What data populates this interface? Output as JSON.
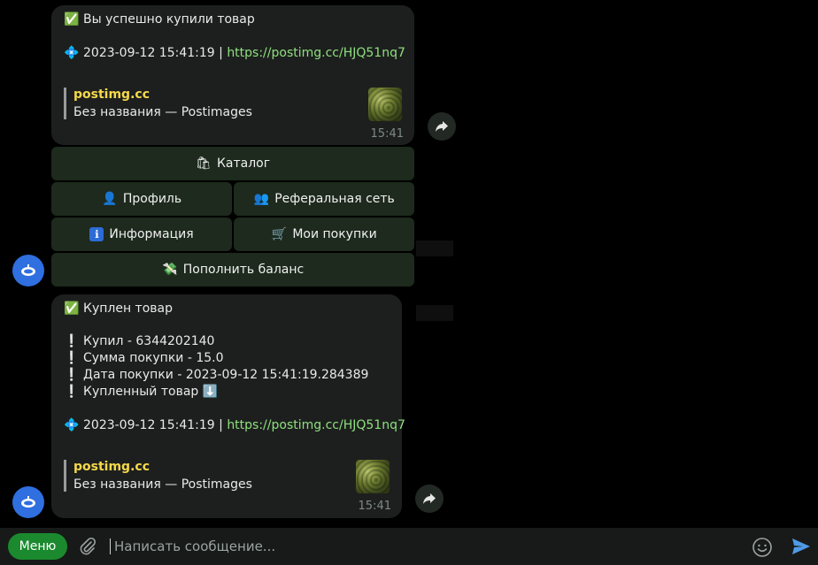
{
  "message1": {
    "title_emoji": "✅",
    "title": "Вы успешно купили товар",
    "info_emoji": "💠",
    "info_text": "2023-09-12 15:41:19 | ",
    "link": "https://postimg.cc/HJQ51nq7",
    "preview_site": "postimg.cc",
    "preview_title": "Без названия — Postimages",
    "time": "15:41"
  },
  "keyboard": {
    "catalog": {
      "emoji": "🛍",
      "label": "Каталог"
    },
    "profile": {
      "emoji": "👤",
      "label": "Профиль"
    },
    "referral": {
      "emoji": "👥",
      "label": "Реферальная сеть"
    },
    "info": {
      "emoji": "ℹ",
      "label": "Информация"
    },
    "purchases": {
      "emoji": "🛒",
      "label": "Мои покупки"
    },
    "topup": {
      "emoji": "💸",
      "label": "Пополнить баланс"
    }
  },
  "message2": {
    "title_emoji": "✅",
    "title": "Куплен товар",
    "detail_emoji": "❕",
    "details": [
      "Купил - 6344202140",
      "Сумма покупки - 15.0",
      "Дата покупки - 2023-09-12 15:41:19.284389",
      "Купленный товар ⬇️"
    ],
    "info_emoji": "💠",
    "info_text": "2023-09-12 15:41:19 | ",
    "link": "https://postimg.cc/HJQ51nq7",
    "preview_site": "postimg.cc",
    "preview_title": "Без названия — Postimages",
    "time": "15:41"
  },
  "composer": {
    "menu_label": "Меню",
    "placeholder": "Написать сообщение..."
  },
  "colors": {
    "bubble": "#1d1f1e",
    "keyboard_button": "#1d2a1d",
    "link": "#8ee07e",
    "preview_site": "#f5d94a",
    "menu_button": "#1b8a2e",
    "avatar": "#2f6fe0"
  }
}
